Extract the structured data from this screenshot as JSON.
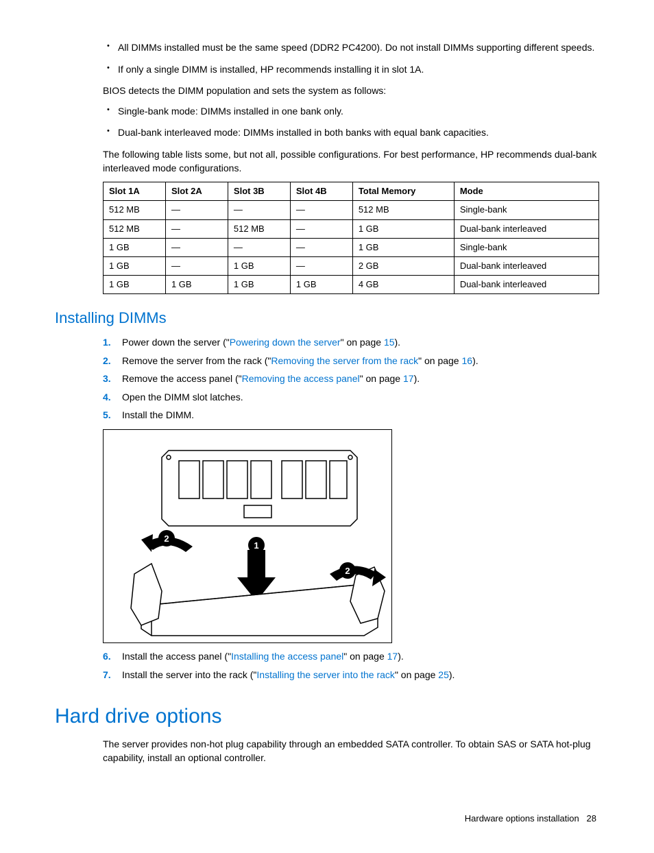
{
  "bullets_top": [
    "All DIMMs installed must be the same speed (DDR2 PC4200). Do not install DIMMs supporting different speeds.",
    "If only a single DIMM is installed, HP recommends installing it in slot 1A."
  ],
  "para_bios": "BIOS detects the DIMM population and sets the system as follows:",
  "bullets_modes": [
    "Single-bank mode: DIMMs installed in one bank only.",
    "Dual-bank interleaved mode: DIMMs installed in both banks with equal bank capacities."
  ],
  "para_table_intro": "The following table lists some, but not all, possible configurations. For best performance, HP recommends dual-bank interleaved mode configurations.",
  "table": {
    "headers": [
      "Slot 1A",
      "Slot 2A",
      "Slot 3B",
      "Slot 4B",
      "Total Memory",
      "Mode"
    ],
    "rows": [
      [
        "512 MB",
        "—",
        "—",
        "—",
        "512 MB",
        "Single-bank"
      ],
      [
        "512 MB",
        "—",
        "512 MB",
        "—",
        "1 GB",
        "Dual-bank interleaved"
      ],
      [
        "1 GB",
        "—",
        "—",
        "—",
        "1 GB",
        "Single-bank"
      ],
      [
        "1 GB",
        "—",
        "1 GB",
        "—",
        "2 GB",
        "Dual-bank interleaved"
      ],
      [
        "1 GB",
        "1 GB",
        "1 GB",
        "1 GB",
        "4 GB",
        "Dual-bank interleaved"
      ]
    ]
  },
  "heading_install": "Installing DIMMs",
  "steps_a": [
    {
      "pre": "Power down the server (\"",
      "link": "Powering down the server",
      "post": "\" on page ",
      "page": "15",
      "tail": ")."
    },
    {
      "pre": "Remove the server from the rack (\"",
      "link": "Removing the server from the rack",
      "post": "\" on page ",
      "page": "16",
      "tail": ")."
    },
    {
      "pre": "Remove the access panel (\"",
      "link": "Removing the access panel",
      "post": "\" on page ",
      "page": "17",
      "tail": ")."
    },
    {
      "plain": "Open the DIMM slot latches."
    },
    {
      "plain": "Install the DIMM."
    }
  ],
  "steps_b": [
    {
      "pre": "Install the access panel (\"",
      "link": "Installing the access panel",
      "post": "\" on page ",
      "page": "17",
      "tail": ")."
    },
    {
      "pre": "Install the server into the rack (\"",
      "link": "Installing the server into the rack",
      "post": "\" on page ",
      "page": "25",
      "tail": ")."
    }
  ],
  "heading_hdd": "Hard drive options",
  "para_hdd": "The server provides non-hot plug capability through an embedded SATA controller. To obtain SAS or SATA hot-plug capability, install an optional controller.",
  "footer_section": "Hardware options installation",
  "footer_page": "28",
  "figure_labels": {
    "step1": "1",
    "step2a": "2",
    "step2b": "2"
  }
}
